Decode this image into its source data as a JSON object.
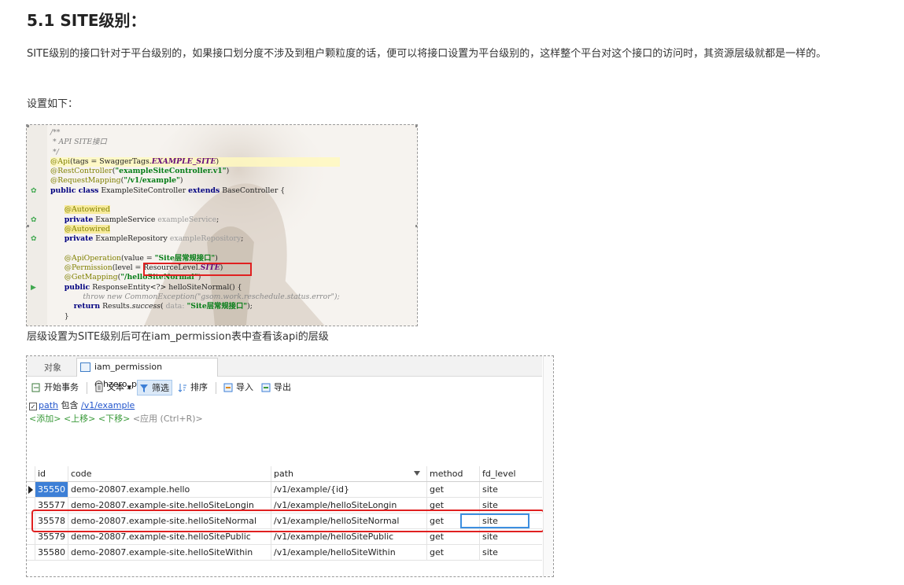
{
  "heading": "5.1 SITE级别：",
  "paragraph1": "SITE级别的接口针对于平台级别的，如果接口划分度不涉及到租户颗粒度的话，便可以将接口设置为平台级别的，这样整个平台对这个接口的访问时，其资源层级就都是一样的。",
  "paragraph2": "设置如下：",
  "caption": "层级设置为SITE级别后可在iam_permission表中查看该api的层级",
  "code": {
    "c1": "/**",
    "c2": " * API SITE接口",
    "c3": " */",
    "api_ann": "@Api",
    "api_args": "(tags = SwaggerTags.",
    "api_const": "EXAMPLE_SITE",
    "rest_ann": "@RestController",
    "rest_str": "\"exampleSiteController.v1\"",
    "reqmap_ann": "@RequestMapping",
    "reqmap_str": "\"/v1/example\"",
    "kw_public_class": "public class",
    "class_name": "ExampleSiteController",
    "kw_extends": "extends",
    "class_tail": "BaseController {",
    "autowired": "@Autowired",
    "kw_private": "private",
    "svc_type": "ExampleService",
    "svc_field": "exampleService",
    "repo_type": "ExampleRepository",
    "repo_field": "exampleRepository",
    "apiop_ann": "@ApiOperation",
    "apiop_args": "(value = ",
    "apiop_str": "\"Site层常规接口\"",
    "perm_ann": "@Permission",
    "perm_args": "(level = ResourceLevel.",
    "perm_const": "SITE",
    "getmap_ann": "@GetMapping",
    "getmap_str": "\"/helloSiteNormal\"",
    "kw_public": "public",
    "method_sig": "ResponseEntity<?> helloSiteNormal() {",
    "throw_line": "throw new CommonException(\"gsom.work.reschedule.status.error\");",
    "kw_return": "return",
    "ret_call": "Results.",
    "ret_method": "success",
    "ret_hint": "data:",
    "ret_str": "\"Site层常规接口\"",
    "close_brace": "}"
  },
  "db": {
    "tab_objects": "对象",
    "tab_table": "iam_permission @hzero_pla...",
    "toolbar": {
      "begin_tx": "开始事务",
      "text": "文本",
      "filter": "筛选",
      "sort": "排序",
      "import": "导入",
      "export": "导出"
    },
    "filter": {
      "field": "path",
      "op": "包含",
      "value": "/v1/example"
    },
    "filter_ops": {
      "add": "<添加>",
      "up": "<上移>",
      "down": "<下移>",
      "apply": "<应用 (Ctrl+R)>"
    },
    "columns": [
      "id",
      "code",
      "path",
      "method",
      "fd_level"
    ],
    "rows": [
      [
        "35550",
        "demo-20807.example.hello",
        "/v1/example/{id}",
        "get",
        "site"
      ],
      [
        "35577",
        "demo-20807.example-site.helloSiteLongin",
        "/v1/example/helloSiteLongin",
        "get",
        "site"
      ],
      [
        "35578",
        "demo-20807.example-site.helloSiteNormal",
        "/v1/example/helloSiteNormal",
        "get",
        "site"
      ],
      [
        "35579",
        "demo-20807.example-site.helloSitePublic",
        "/v1/example/helloSitePublic",
        "get",
        "site"
      ],
      [
        "35580",
        "demo-20807.example-site.helloSiteWithin",
        "/v1/example/helloSiteWithin",
        "get",
        "site"
      ]
    ]
  },
  "colors": {
    "highlight_box": "#e02020",
    "selected_cell": "#3d8fe0",
    "selected_id": "#3d7fd6"
  }
}
